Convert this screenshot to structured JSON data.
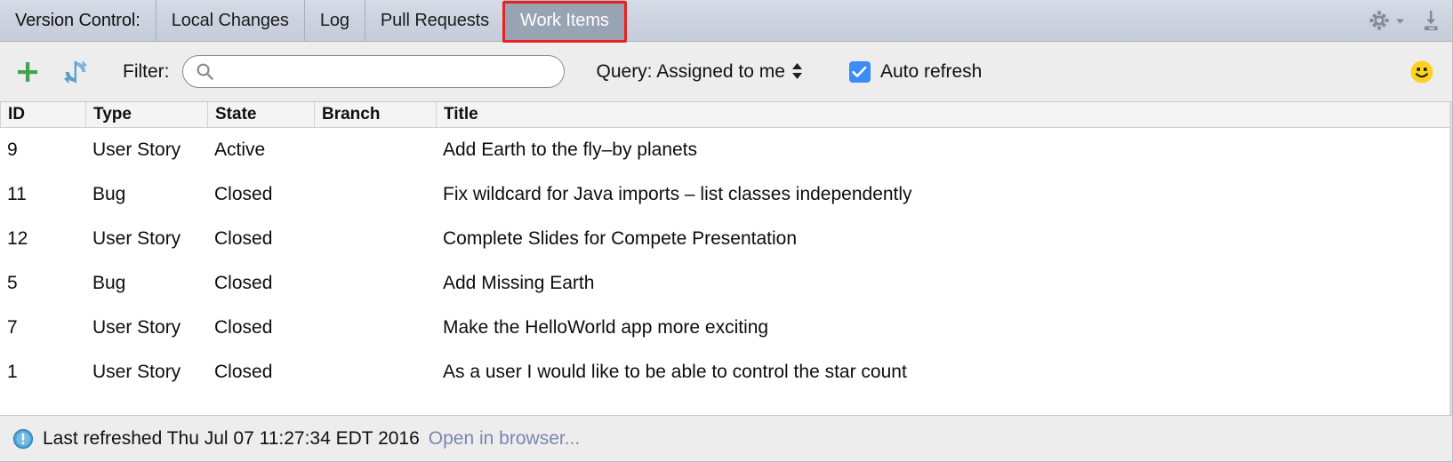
{
  "tabbar": {
    "tabs": [
      {
        "label": "Version Control:",
        "selected": false
      },
      {
        "label": "Local Changes",
        "selected": false
      },
      {
        "label": "Log",
        "selected": false
      },
      {
        "label": "Pull Requests",
        "selected": false
      },
      {
        "label": "Work Items",
        "selected": true
      }
    ],
    "highlighted_tab": "Work Items",
    "highlight_color": "#e8231f",
    "selected_tab_bg": "#98a3b3",
    "actions": [
      {
        "icon": "gear-icon",
        "label": "Settings"
      },
      {
        "icon": "hide-panel-icon",
        "label": "Hide"
      }
    ]
  },
  "toolbar": {
    "add_label": "+",
    "refresh_label": "Refresh",
    "filter_label": "Filter:",
    "search": {
      "value": "",
      "placeholder": ""
    },
    "query_label": "Query: Assigned to me",
    "auto_refresh_label": "Auto refresh",
    "auto_refresh_checked": true,
    "checkbox_color": "#3b8cf4",
    "plus_color": "#47a04f",
    "refresh_color": "#6fa8d8",
    "smiley_color": "#ffd21e"
  },
  "table": {
    "columns": [
      "ID",
      "Type",
      "State",
      "Branch",
      "Title"
    ],
    "rows": [
      {
        "id": "9",
        "type": "User Story",
        "state": "Active",
        "branch": "",
        "title": "Add Earth to the fly–by planets"
      },
      {
        "id": "11",
        "type": "Bug",
        "state": "Closed",
        "branch": "",
        "title": "Fix wildcard for Java imports – list classes independently"
      },
      {
        "id": "12",
        "type": "User Story",
        "state": "Closed",
        "branch": "",
        "title": "Complete Slides for Compete Presentation"
      },
      {
        "id": "5",
        "type": "Bug",
        "state": "Closed",
        "branch": "",
        "title": "Add Missing Earth"
      },
      {
        "id": "7",
        "type": "User Story",
        "state": "Closed",
        "branch": "",
        "title": "Make the HelloWorld app more exciting"
      },
      {
        "id": "1",
        "type": "User Story",
        "state": "Closed",
        "branch": "",
        "title": "As a user I would like to be able to control the star count"
      }
    ]
  },
  "statusbar": {
    "icon": "info-icon",
    "message": "Last refreshed Thu Jul 07 11:27:34 EDT 2016",
    "link_label": "Open in browser...",
    "link_color": "#7a86b4"
  }
}
